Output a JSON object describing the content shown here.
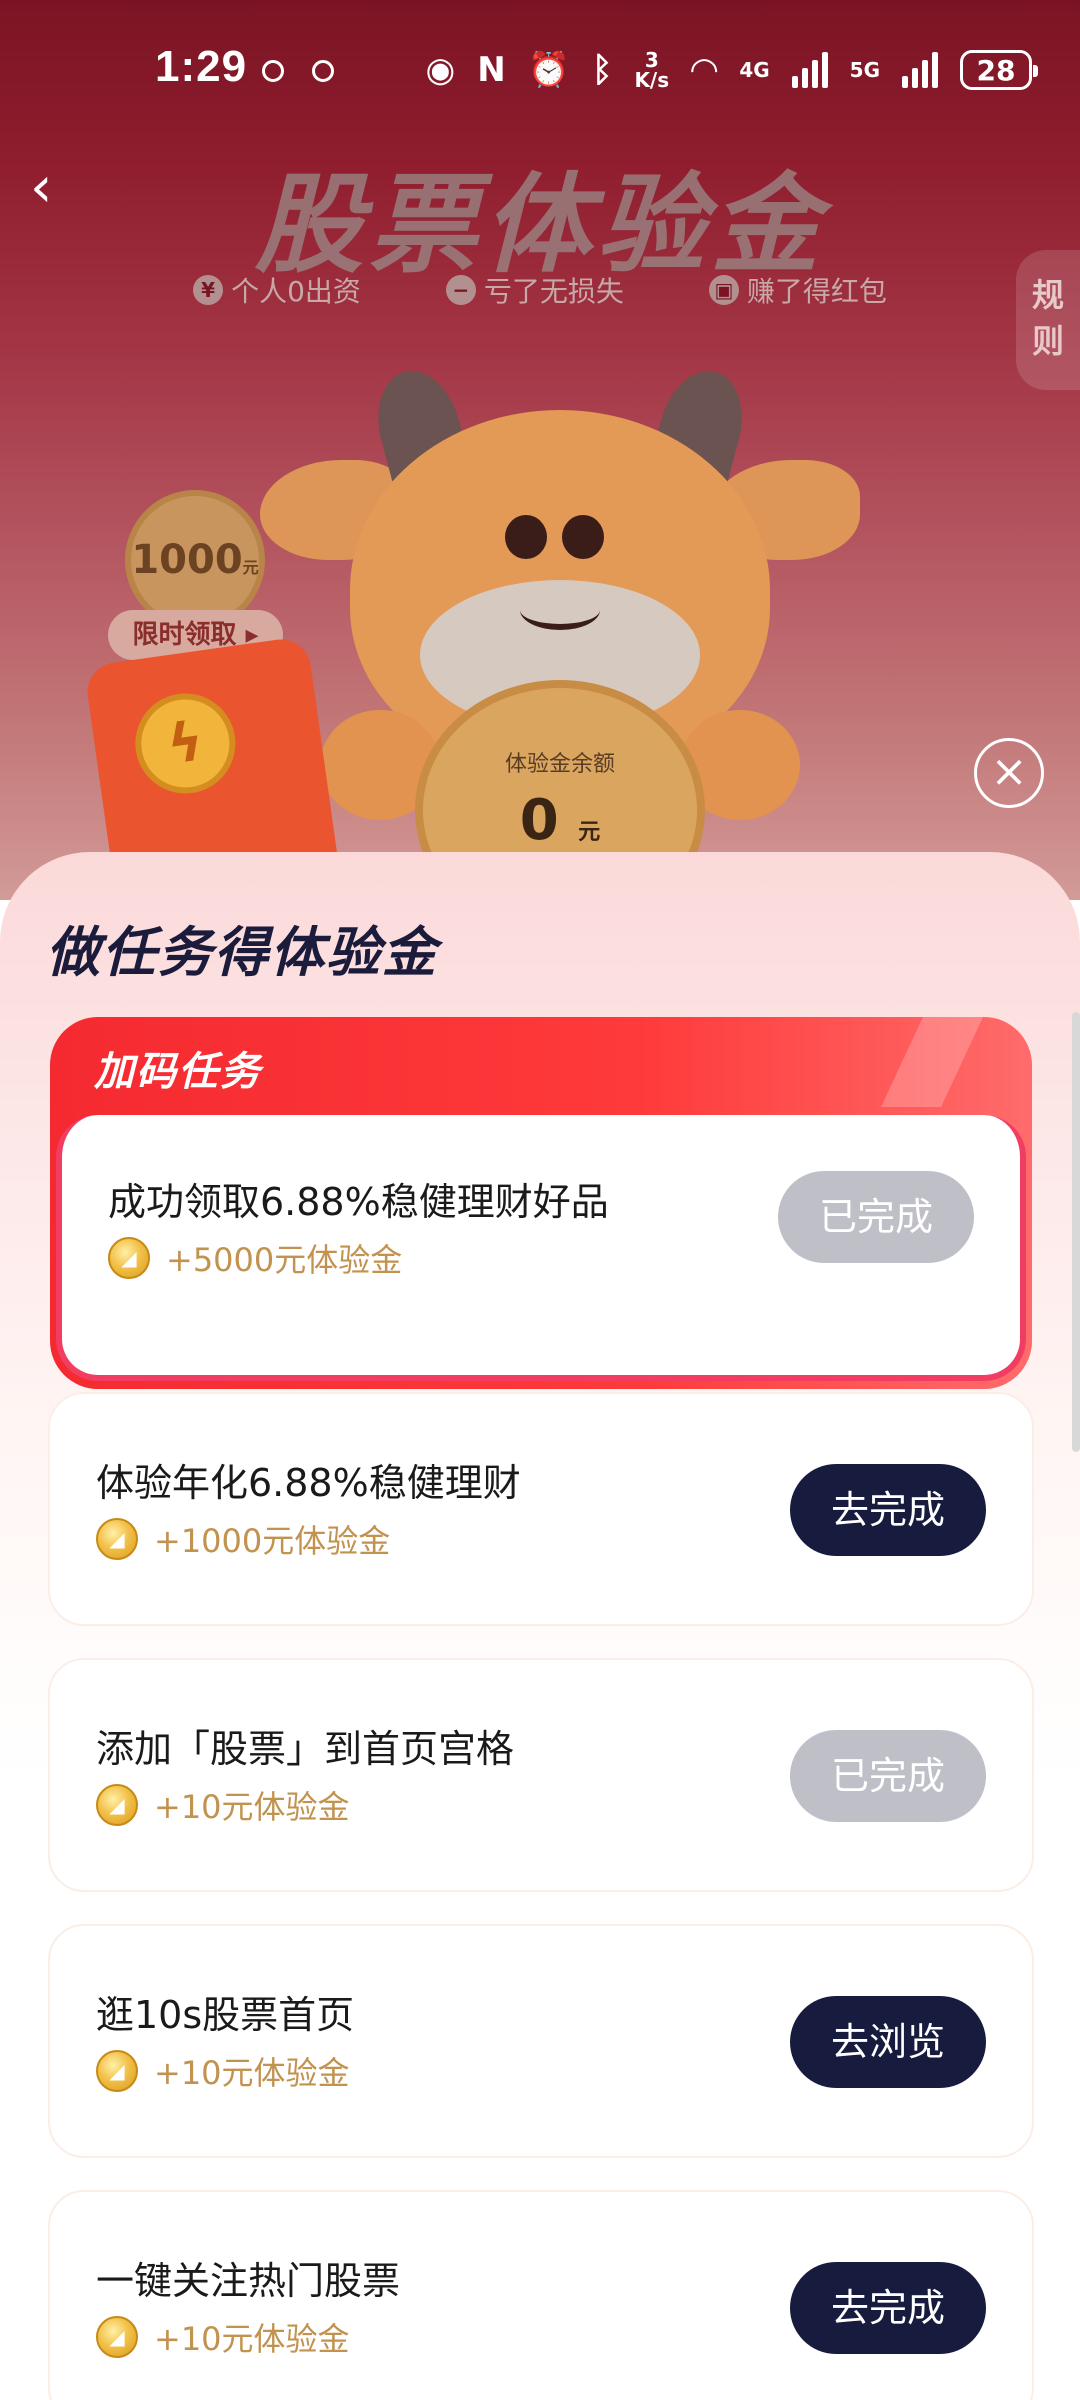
{
  "status": {
    "time": "1:29",
    "speed_top": "3",
    "speed_unit": "K/s",
    "net1": "4G",
    "net2": "5G",
    "battery": "28"
  },
  "hero": {
    "title": "股票体验金",
    "features": [
      {
        "icon": "¥",
        "label": "个人0出资"
      },
      {
        "icon": "−",
        "label": "亏了无损失"
      },
      {
        "icon": "▣",
        "label": "赚了得红包"
      }
    ],
    "rules_label": "规则",
    "coin_1000": "1000",
    "coin_1000_unit": "元",
    "limited_label": "限时领取 ▸",
    "balance_label": "体验金余额",
    "balance_value": "0",
    "balance_unit": "元"
  },
  "sheet": {
    "title": "做任务得体验金",
    "bonus_header": "加码任务",
    "tasks": [
      {
        "title": "成功领取6.88%稳健理财好品",
        "reward": "+5000元体验金",
        "button": "已完成",
        "state": "done"
      },
      {
        "title": "体验年化6.88%稳健理财",
        "reward": "+1000元体验金",
        "button": "去完成",
        "state": "todo"
      },
      {
        "title": "添加「股票」到首页宫格",
        "reward": "+10元体验金",
        "button": "已完成",
        "state": "done"
      },
      {
        "title": "逛10s股票首页",
        "reward": "+10元体验金",
        "button": "去浏览",
        "state": "todo"
      },
      {
        "title": "一键关注热门股票",
        "reward": "+10元体验金",
        "button": "去完成",
        "state": "todo"
      }
    ]
  },
  "icons": {
    "back": "chevron-left-icon",
    "close": "close-icon",
    "coin": "gold-coin-icon"
  },
  "colors": {
    "hero_top": "#7a1424",
    "accent_red": "#f42a30",
    "done_button": "#bfc0c7",
    "go_button": "#171c3e",
    "reward_text": "#c2924f"
  }
}
